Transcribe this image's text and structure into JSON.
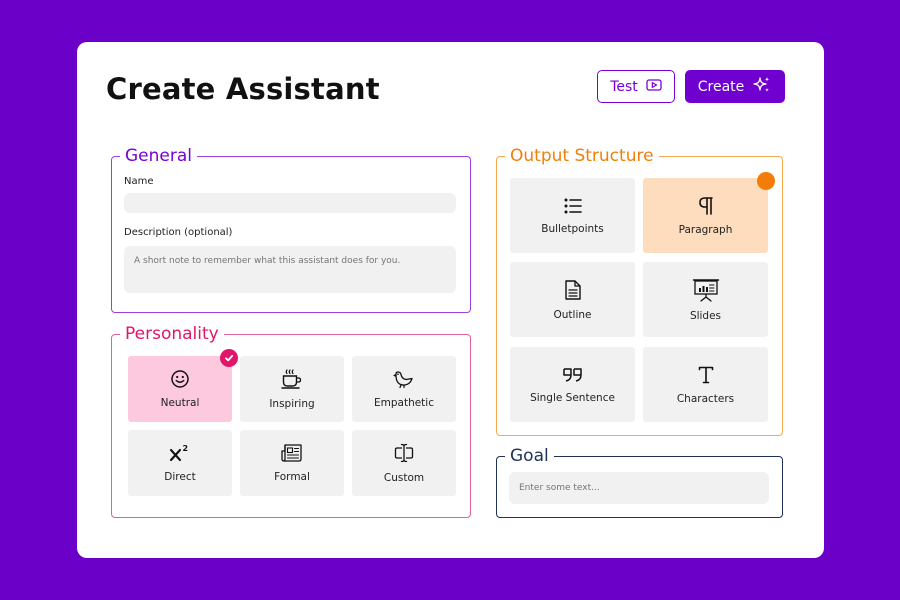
{
  "header": {
    "title": "Create Assistant",
    "test_label": "Test",
    "create_label": "Create"
  },
  "general": {
    "legend": "General",
    "name_label": "Name",
    "name_value": "",
    "description_label": "Description (optional)",
    "description_placeholder": "A short note to remember what this assistant does for you."
  },
  "personality": {
    "legend": "Personality",
    "selected": "Neutral",
    "options": [
      {
        "label": "Neutral",
        "icon": "smiley-icon"
      },
      {
        "label": "Inspiring",
        "icon": "coffee-cup-icon"
      },
      {
        "label": "Empathetic",
        "icon": "bird-icon"
      },
      {
        "label": "Direct",
        "icon": "x-squared-icon"
      },
      {
        "label": "Formal",
        "icon": "newspaper-icon"
      },
      {
        "label": "Custom",
        "icon": "text-cursor-icon"
      }
    ]
  },
  "output_structure": {
    "legend": "Output Structure",
    "selected": "Paragraph",
    "options": [
      {
        "label": "Bulletpoints",
        "icon": "bullet-list-icon"
      },
      {
        "label": "Paragraph",
        "icon": "pilcrow-icon"
      },
      {
        "label": "Outline",
        "icon": "document-icon"
      },
      {
        "label": "Slides",
        "icon": "presentation-icon"
      },
      {
        "label": "Single Sentence",
        "icon": "quote-icon"
      },
      {
        "label": "Characters",
        "icon": "letter-t-icon"
      }
    ]
  },
  "goal": {
    "legend": "Goal",
    "placeholder": "Enter some text..."
  },
  "colors": {
    "background": "#6b00c9",
    "primary": "#7000d0",
    "personality_accent": "#e0166a",
    "output_accent": "#f47d0a",
    "goal_accent": "#1f3156"
  }
}
